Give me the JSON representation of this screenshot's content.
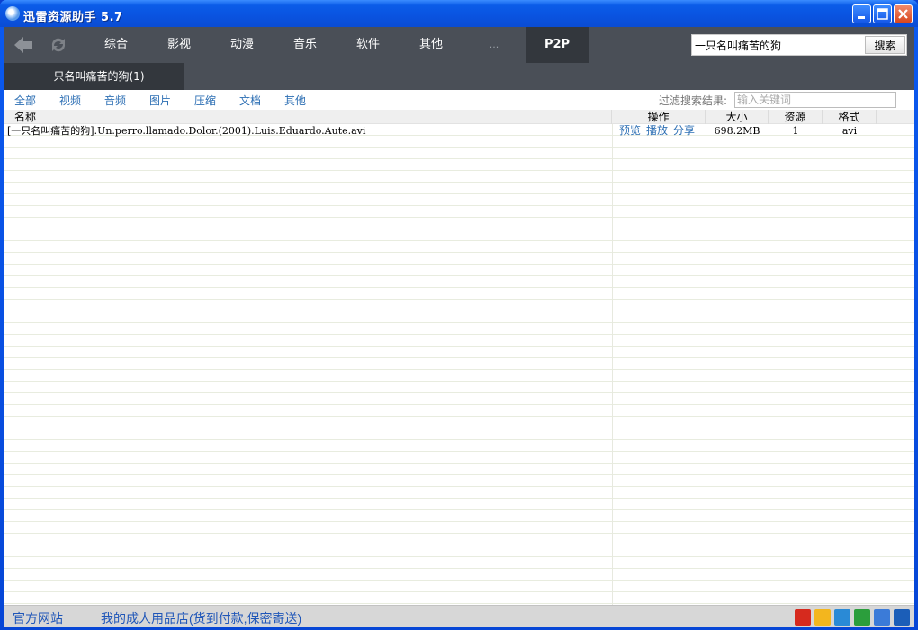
{
  "window": {
    "title": "迅雷资源助手 5.7"
  },
  "nav": {
    "items": [
      "综合",
      "影视",
      "动漫",
      "音乐",
      "软件",
      "其他",
      "...",
      "P2P"
    ],
    "active": "P2P"
  },
  "search": {
    "value": "一只名叫痛苦的狗",
    "button_label": "搜索"
  },
  "results_tab": {
    "label": "一只名叫痛苦的狗(1)"
  },
  "filter": {
    "tabs": [
      "全部",
      "视频",
      "音频",
      "图片",
      "压缩",
      "文档",
      "其他"
    ],
    "active": "全部",
    "label": "过滤搜索结果:",
    "placeholder": "输入关键词"
  },
  "table": {
    "columns": {
      "name": "名称",
      "ops": "操作",
      "size": "大小",
      "sources": "资源",
      "format": "格式"
    },
    "rows": [
      {
        "name": "[一只名叫痛苦的狗].Un.perro.llamado.Dolor.(2001).Luis.Eduardo.Aute.avi",
        "ops": [
          "预览",
          "播放",
          "分享"
        ],
        "size": "698.2MB",
        "sources": "1",
        "format": "avi"
      }
    ]
  },
  "status": {
    "official_site": "官方网站",
    "ad_link": "我的成人用品店(货到付款,保密寄送)",
    "share_icons": [
      {
        "name": "weibo-icon",
        "color": "#d62a1e"
      },
      {
        "name": "qzone-icon",
        "color": "#f3b61e"
      },
      {
        "name": "pengyou-icon",
        "color": "#2a8ad6"
      },
      {
        "name": "douban-icon",
        "color": "#2b9e3c"
      },
      {
        "name": "tieba-icon",
        "color": "#3b7bd8"
      },
      {
        "name": "renren-icon",
        "color": "#1b5eb8"
      }
    ]
  },
  "colors": {
    "nav_bg": "#4a4f57",
    "nav_active": "#33373d",
    "link": "#2d6fb4"
  }
}
